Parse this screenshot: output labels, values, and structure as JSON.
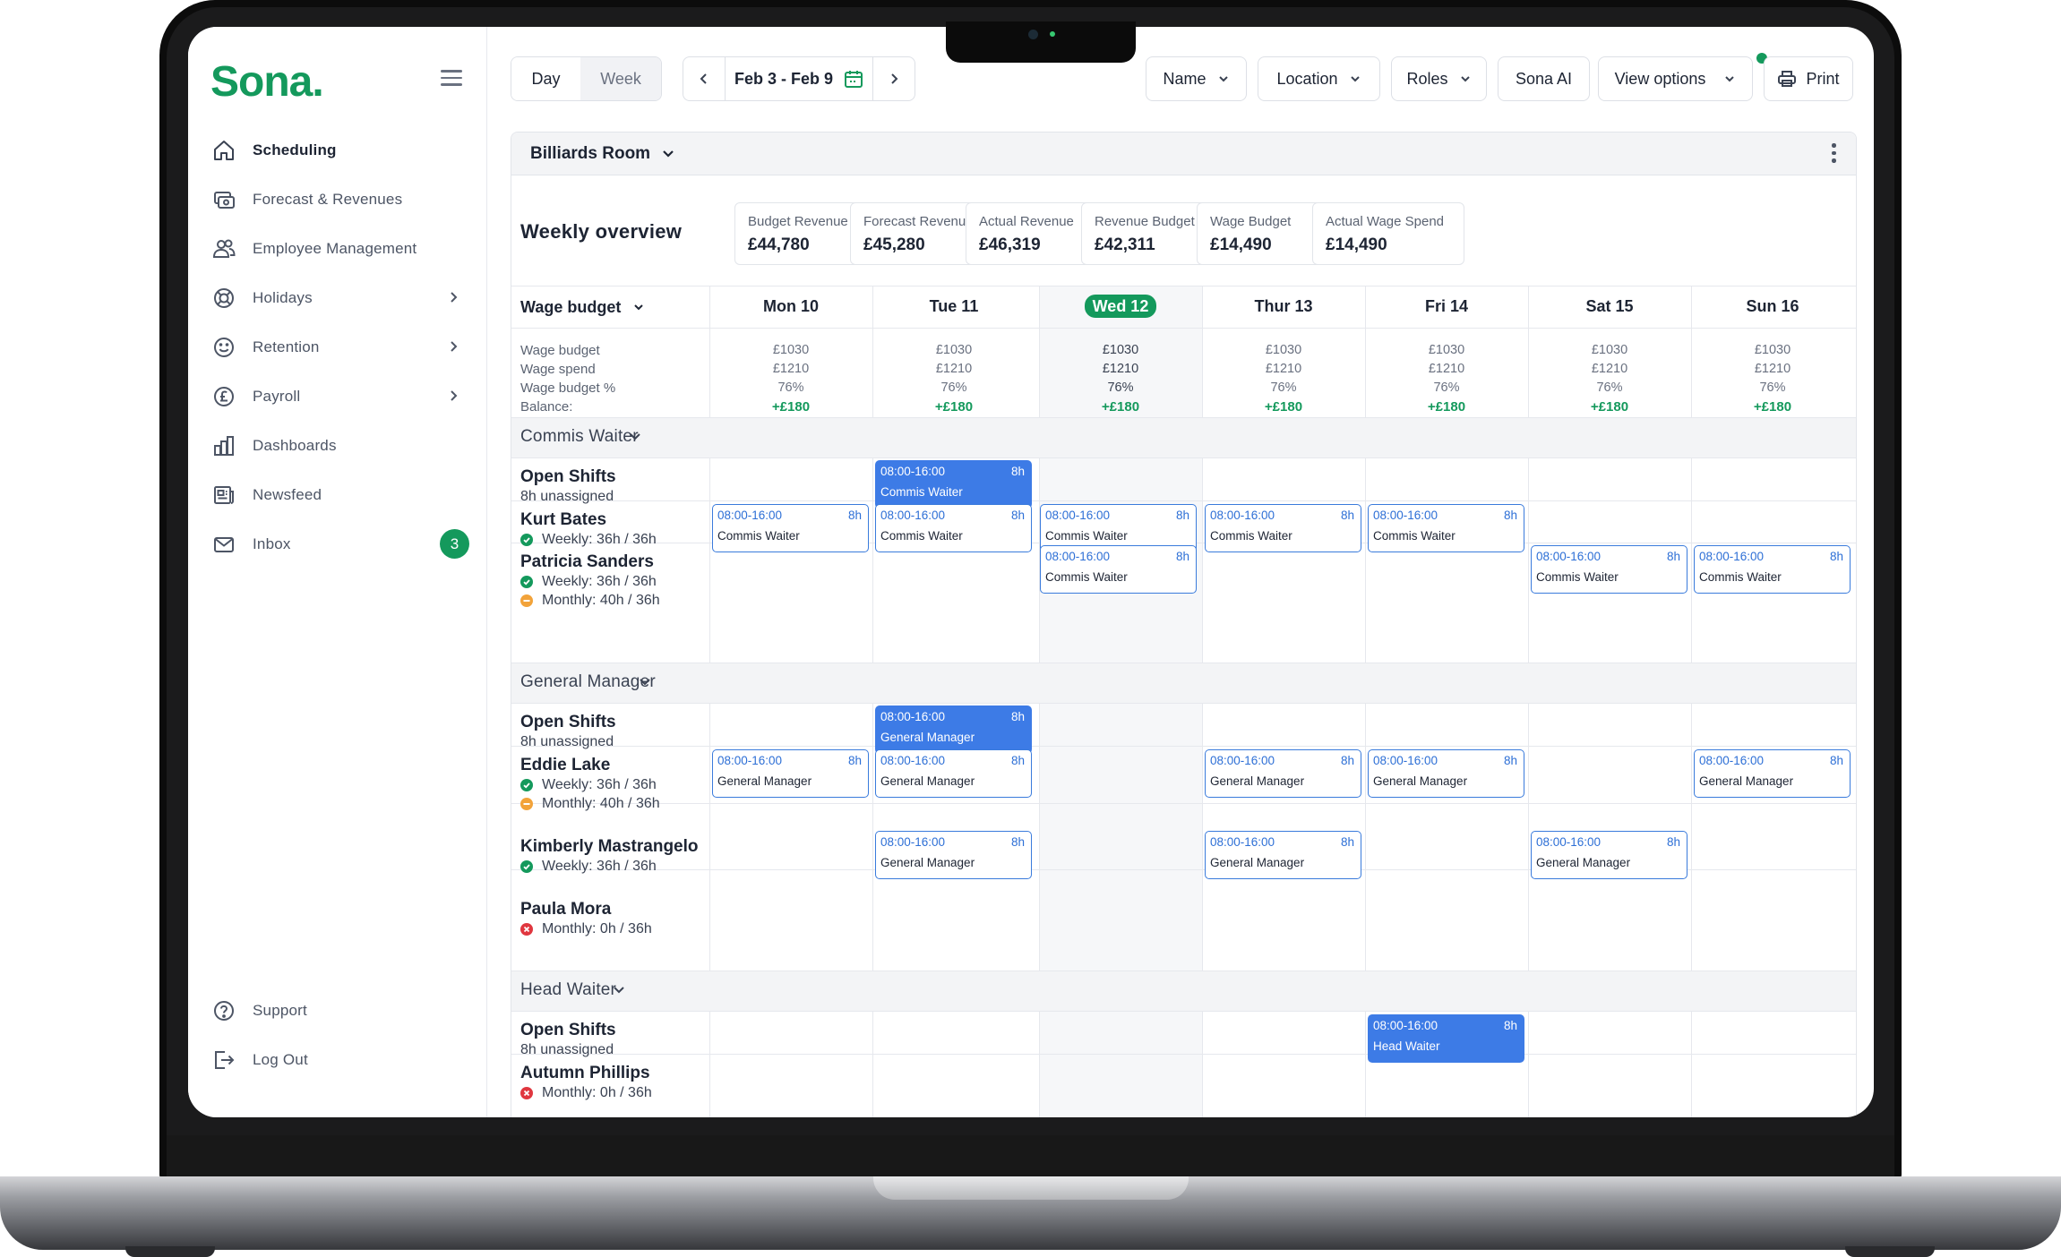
{
  "app": {
    "logo": "Sona",
    "logo_dot": "."
  },
  "sidebar": {
    "items": [
      {
        "label": "Scheduling"
      },
      {
        "label": "Forecast & Revenues"
      },
      {
        "label": "Employee Management"
      },
      {
        "label": "Holidays"
      },
      {
        "label": "Retention"
      },
      {
        "label": "Payroll"
      },
      {
        "label": "Dashboards"
      },
      {
        "label": "Newsfeed"
      },
      {
        "label": "Inbox",
        "badge": "3"
      }
    ],
    "bottom": [
      {
        "label": "Support"
      },
      {
        "label": "Log Out"
      }
    ]
  },
  "toolbar": {
    "day": "Day",
    "week": "Week",
    "date_range": "Feb 3 - Feb 9",
    "name": "Name",
    "location": "Location",
    "roles": "Roles",
    "sona_ai": "Sona AI",
    "view_options": "View options",
    "print": "Print"
  },
  "room": {
    "name": "Billiards Room"
  },
  "overview": {
    "title": "Weekly overview",
    "kpis": [
      {
        "label": "Budget Revenue",
        "value": "£44,780"
      },
      {
        "label": "Forecast Revenue",
        "value": "£45,280"
      },
      {
        "label": "Actual Revenue",
        "value": "£46,319"
      },
      {
        "label": "Revenue Budget",
        "value": "£42,311"
      },
      {
        "label": "Wage Budget",
        "value": "£14,490"
      },
      {
        "label": "Actual Wage Spend",
        "value": "£14,490"
      }
    ]
  },
  "wage": {
    "header": "Wage budget",
    "rows": [
      "Wage budget",
      "Wage spend",
      "Wage budget %",
      "Balance:"
    ],
    "budget": "£1030",
    "spend": "£1210",
    "pct": "76%",
    "balance": "+£180"
  },
  "days": [
    "Mon 10",
    "Tue 11",
    "Wed 12",
    "Thur 13",
    "Fri 14",
    "Sat 15",
    "Sun 16"
  ],
  "today_index": 2,
  "shift": {
    "time": "08:00-16:00",
    "hours": "8h"
  },
  "sections": [
    {
      "title": "Commis Waiter",
      "role": "Commis Waiter"
    },
    {
      "title": "General Manager",
      "role": "General Manager"
    },
    {
      "title": "Head Waiter",
      "role": "Head Waiter"
    }
  ],
  "employees": {
    "open_shifts": "Open Shifts",
    "unassigned": "8h unassigned",
    "kurt": {
      "name": "Kurt Bates",
      "weekly": "Weekly: 36h / 36h"
    },
    "patricia": {
      "name": "Patricia Sanders",
      "weekly": "Weekly: 36h / 36h",
      "monthly": "Monthly: 40h / 36h"
    },
    "eddie": {
      "name": "Eddie Lake",
      "weekly": "Weekly: 36h / 36h",
      "monthly": "Monthly: 40h / 36h"
    },
    "kimberly": {
      "name": "Kimberly Mastrangelo",
      "weekly": "Weekly: 36h / 36h"
    },
    "paula": {
      "name": "Paula Mora",
      "monthly": "Monthly: 0h / 36h"
    },
    "autumn": {
      "name": "Autumn Phillips",
      "monthly": "Monthly: 0h / 36h"
    }
  },
  "colors": {
    "brand": "#14995c",
    "shift_blue": "#3d7be6",
    "ok": "#14995c",
    "warn": "#f2a33a",
    "error": "#e0373f"
  }
}
